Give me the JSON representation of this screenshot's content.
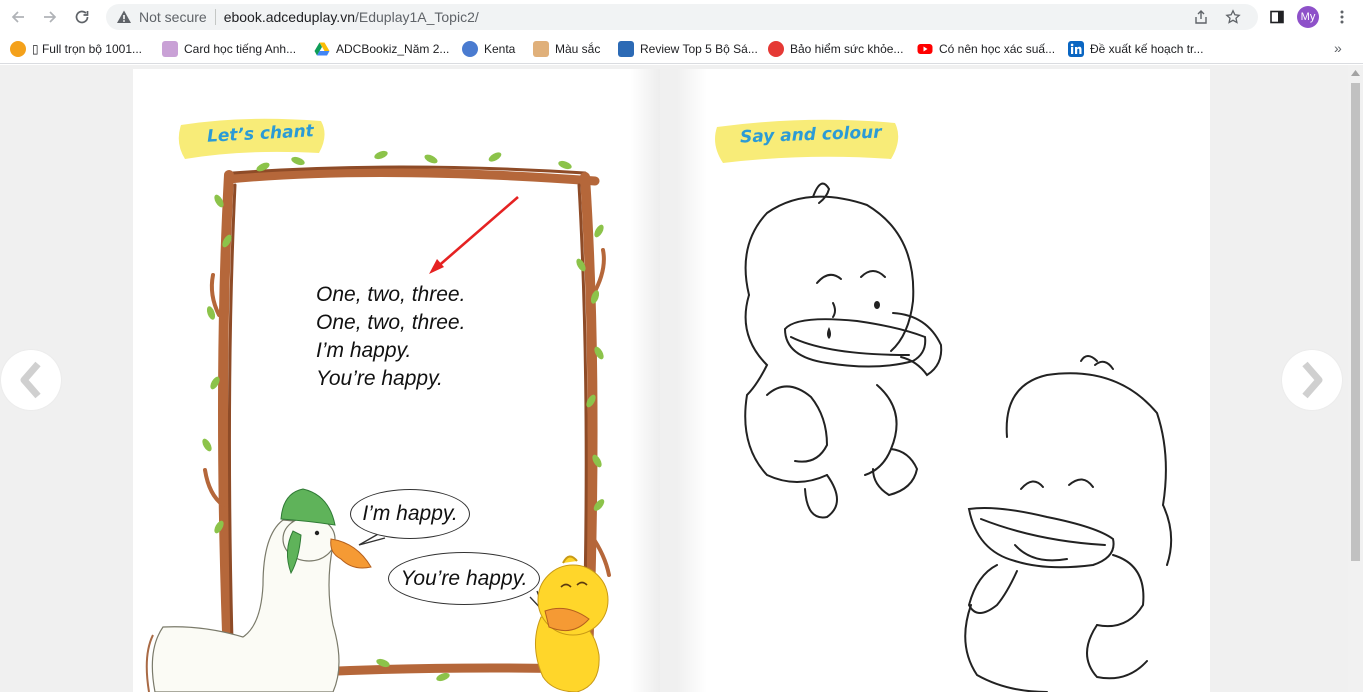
{
  "browser": {
    "security_label": "Not secure",
    "url_host": "ebook.adceduplay.vn",
    "url_path": "/Eduplay1A_Topic2/",
    "avatar_initials": "My"
  },
  "bookmarks": [
    {
      "label": "▯ Full trọn bộ 1001...",
      "color": "#f4a11b"
    },
    {
      "label": "Card học tiếng Anh...",
      "color": "#c9a1d6"
    },
    {
      "label": "ADCBookiz_Năm 2...",
      "color": "#1a73e8"
    },
    {
      "label": "Kenta",
      "color": "#4a7bd0"
    },
    {
      "label": "Màu sắc",
      "color": "#e0b07a"
    },
    {
      "label": "Review Top 5 Bộ Sá...",
      "color": "#2c6ab5"
    },
    {
      "label": "Bảo hiểm sức khỏe...",
      "color": "#e53935"
    },
    {
      "label": "Có nên học xác suấ...",
      "color": "#ff0000"
    },
    {
      "label": "Đề xuất kế hoạch tr...",
      "color": "#0a66c2"
    }
  ],
  "bookmarks_overflow": "»",
  "book": {
    "left_page": {
      "banner": "Let’s chant",
      "chant_lines": [
        "One, two, three.",
        "One, two, three.",
        "I’m happy.",
        "You’re happy."
      ],
      "bubble_goose": "I’m happy.",
      "bubble_duck": "You’re happy."
    },
    "right_page": {
      "banner": "Say and colour"
    }
  },
  "colors": {
    "banner_yellow": "#f8ec78",
    "banner_text": "#2b9bd6",
    "frame_brown": "#b5673a",
    "leaf_green": "#8cc34a",
    "arrow_red": "#e52222"
  },
  "icons": [
    "back-icon",
    "forward-icon",
    "reload-icon",
    "warning-icon",
    "share-icon",
    "star-icon",
    "side-panel-icon",
    "menu-icon",
    "chevron-left-icon",
    "chevron-right-icon"
  ]
}
